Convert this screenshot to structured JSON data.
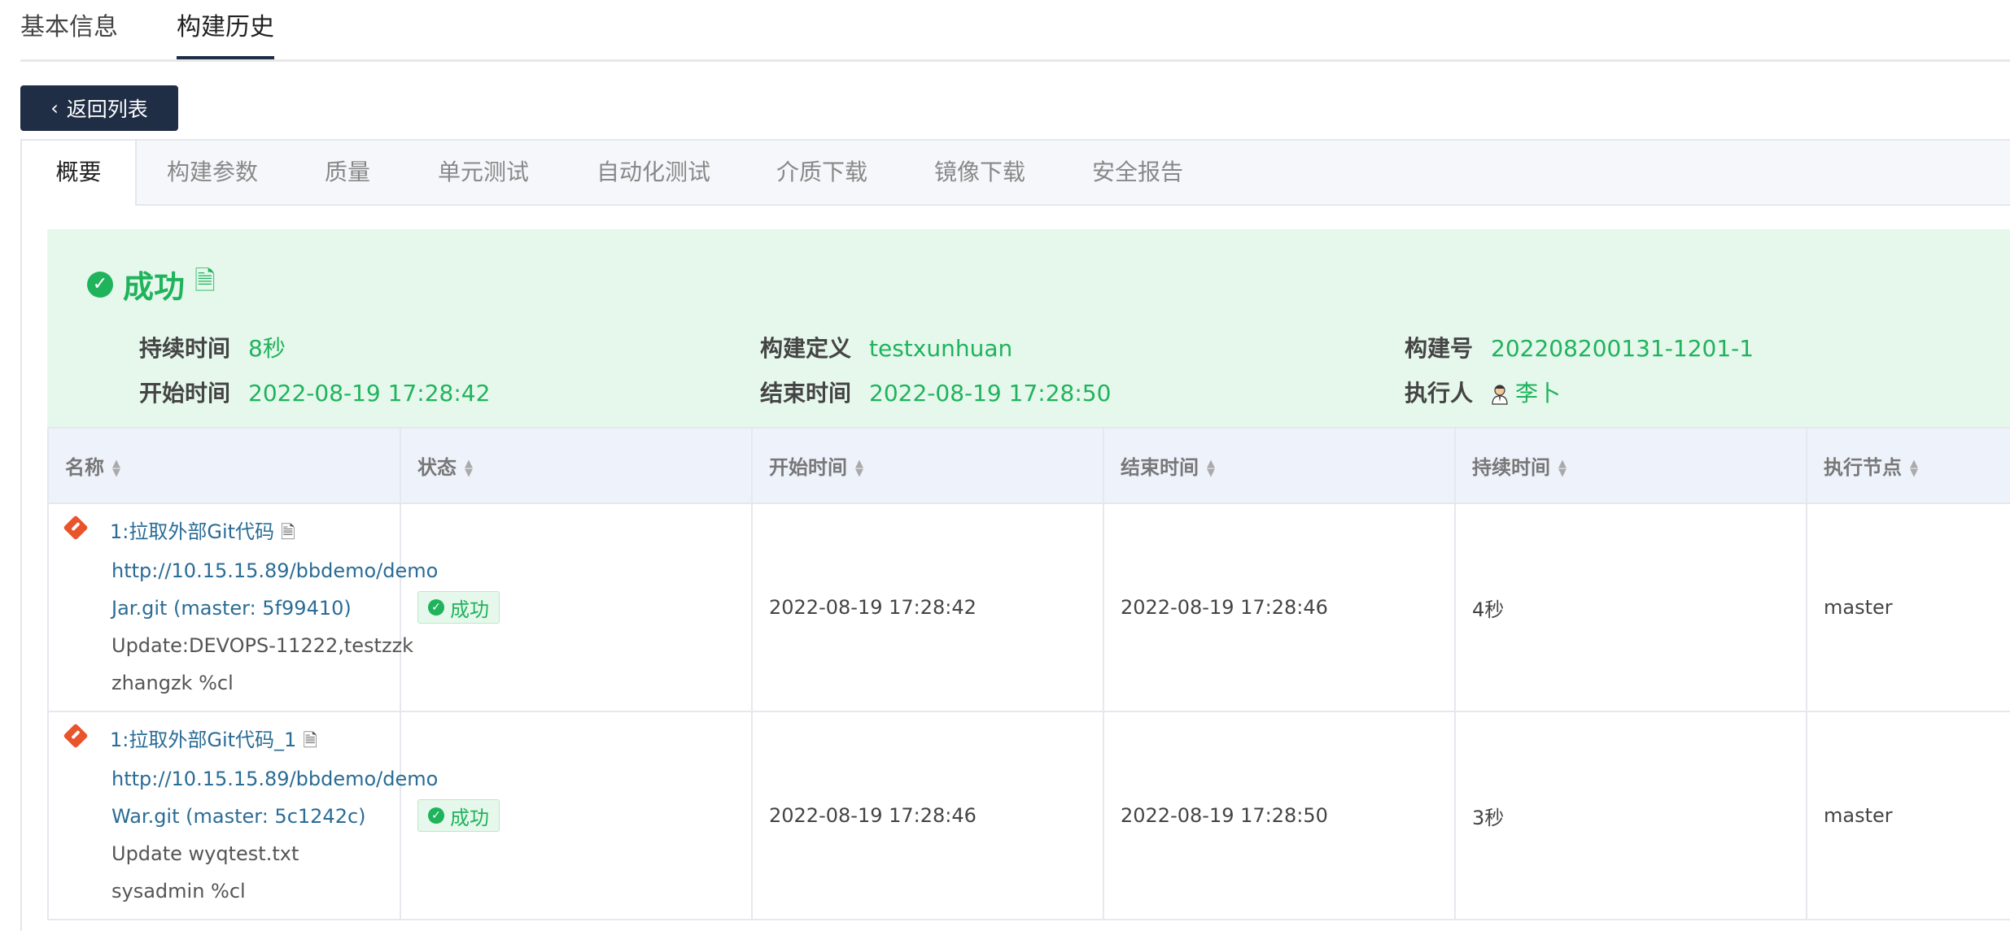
{
  "top_tabs": [
    "基本信息",
    "构建历史"
  ],
  "back_button": {
    "label": "返回列表"
  },
  "sub_tabs": [
    "概要",
    "构建参数",
    "质量",
    "单元测试",
    "自动化测试",
    "介质下载",
    "镜像下载",
    "安全报告"
  ],
  "summary": {
    "status": "成功",
    "duration_label": "持续时间",
    "duration": "8秒",
    "start_label": "开始时间",
    "start": "2022-08-19 17:28:42",
    "definition_label": "构建定义",
    "definition": "testxunhuan",
    "end_label": "结束时间",
    "end": "2022-08-19 17:28:50",
    "build_no_label": "构建号",
    "build_no": "202208200131-1201-1",
    "executor_label": "执行人",
    "executor": "李卜"
  },
  "table": {
    "headers": [
      "名称",
      "状态",
      "开始时间",
      "结束时间",
      "持续时间",
      "执行节点"
    ],
    "rows": [
      {
        "step": "1:拉取外部Git代码",
        "repo_line1": "http://10.15.15.89/bbdemo/demo",
        "repo_line2": "Jar.git (master: 5f99410)",
        "commit_line1": "Update:DEVOPS-11222,testzzk",
        "commit_line2": "zhangzk %cl",
        "status": "成功",
        "start": "2022-08-19 17:28:42",
        "end": "2022-08-19 17:28:46",
        "duration": "4秒",
        "node": "master"
      },
      {
        "step": "1:拉取外部Git代码_1",
        "repo_line1": "http://10.15.15.89/bbdemo/demo",
        "repo_line2": "War.git (master: 5c1242c)",
        "commit_line1": "Update wyqtest.txt",
        "commit_line2": "sysadmin %cl",
        "status": "成功",
        "start": "2022-08-19 17:28:46",
        "end": "2022-08-19 17:28:50",
        "duration": "3秒",
        "node": "master"
      }
    ]
  },
  "colors": {
    "success": "#1fb35c",
    "dark_nav": "#1f2d45",
    "link": "#2a6c96",
    "git": "#e8542b"
  }
}
